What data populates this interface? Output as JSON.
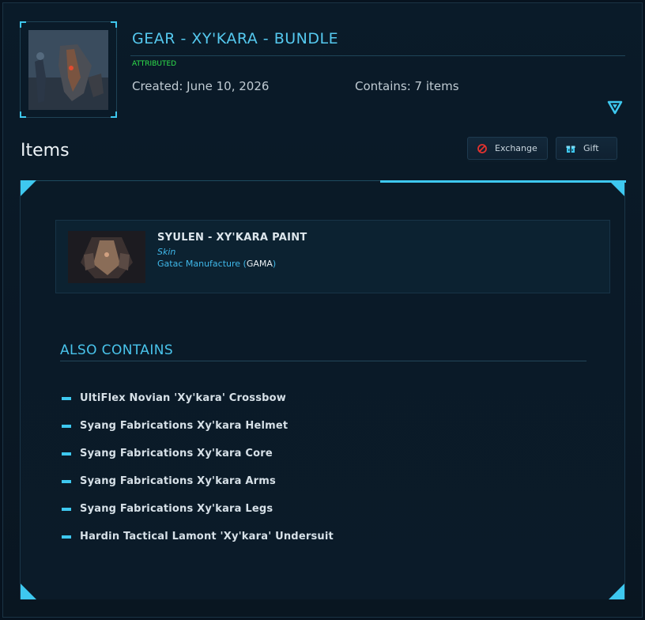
{
  "header": {
    "title": "GEAR - XY'KARA - BUNDLE",
    "status": "ATTRIBUTED",
    "created": "Created: June 10, 2026",
    "contains": "Contains: 7 items"
  },
  "items_section": {
    "heading": "Items",
    "exchange_label": "Exchange",
    "gift_label": "Gift"
  },
  "featured_item": {
    "name": "SYULEN - XY'KARA PAINT",
    "type": "Skin",
    "manufacturer": "Gatac Manufacture",
    "code_open": " (",
    "code": "GAMA",
    "code_close": ")"
  },
  "also_contains": {
    "title": "ALSO CONTAINS",
    "items": [
      "UltiFlex Novian 'Xy'kara' Crossbow",
      "Syang Fabrications Xy'kara Helmet",
      "Syang Fabrications Xy'kara Core",
      "Syang Fabrications Xy'kara Arms",
      "Syang Fabrications Xy'kara Legs",
      "Hardin Tactical Lamont 'Xy'kara' Undersuit"
    ]
  },
  "colors": {
    "accent": "#3ec8ef",
    "status": "#2fe04a",
    "background": "#07131f"
  },
  "icons": {
    "collapse": "triangle-down-icon",
    "exchange": "no-entry-icon",
    "gift": "gift-box-icon"
  }
}
